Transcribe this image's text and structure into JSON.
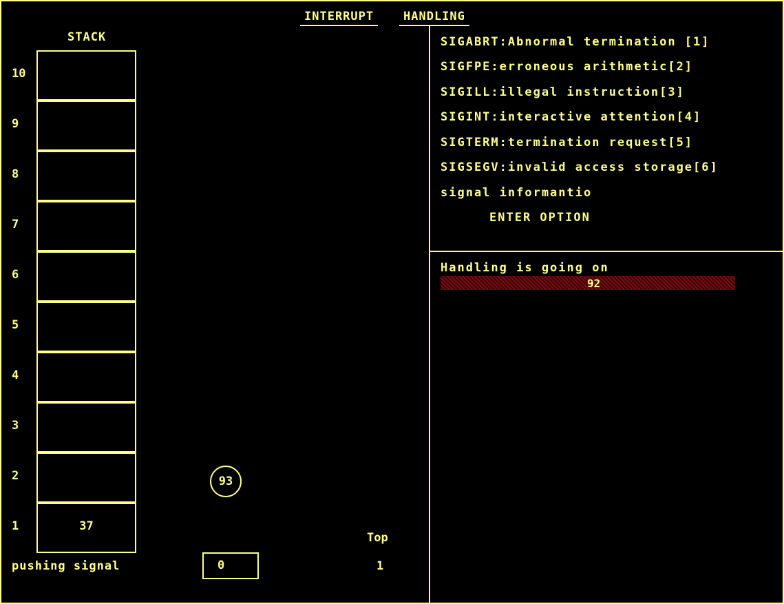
{
  "title": {
    "part1": "INTERRUPT",
    "part2": "HANDLING"
  },
  "stack": {
    "label": "STACK",
    "cells": [
      {
        "index": "10",
        "value": ""
      },
      {
        "index": "9",
        "value": ""
      },
      {
        "index": "8",
        "value": ""
      },
      {
        "index": "7",
        "value": ""
      },
      {
        "index": "6",
        "value": ""
      },
      {
        "index": "5",
        "value": ""
      },
      {
        "index": "4",
        "value": ""
      },
      {
        "index": "3",
        "value": ""
      },
      {
        "index": "2",
        "value": ""
      },
      {
        "index": "1",
        "value": "37"
      }
    ]
  },
  "signal_token": "93",
  "pushing": {
    "label": "pushing signal",
    "value": "0"
  },
  "top": {
    "label": "Top",
    "value": "1"
  },
  "menu": {
    "items": [
      "SIGABRT:Abnormal termination [1]",
      "SIGFPE:erroneous arithmetic[2]",
      "SIGILL:illegal instruction[3]",
      "SIGINT:interactive attention[4]",
      "SIGTERM:termination request[5]",
      "SIGSEGV:invalid access storage[6]",
      "signal informantio"
    ],
    "prompt": "ENTER OPTION"
  },
  "handling": {
    "text": "Handling is going on",
    "progress_value": "92"
  },
  "colors": {
    "fg": "#ffff88",
    "bg": "#000000",
    "progress": "#7a0c12"
  }
}
